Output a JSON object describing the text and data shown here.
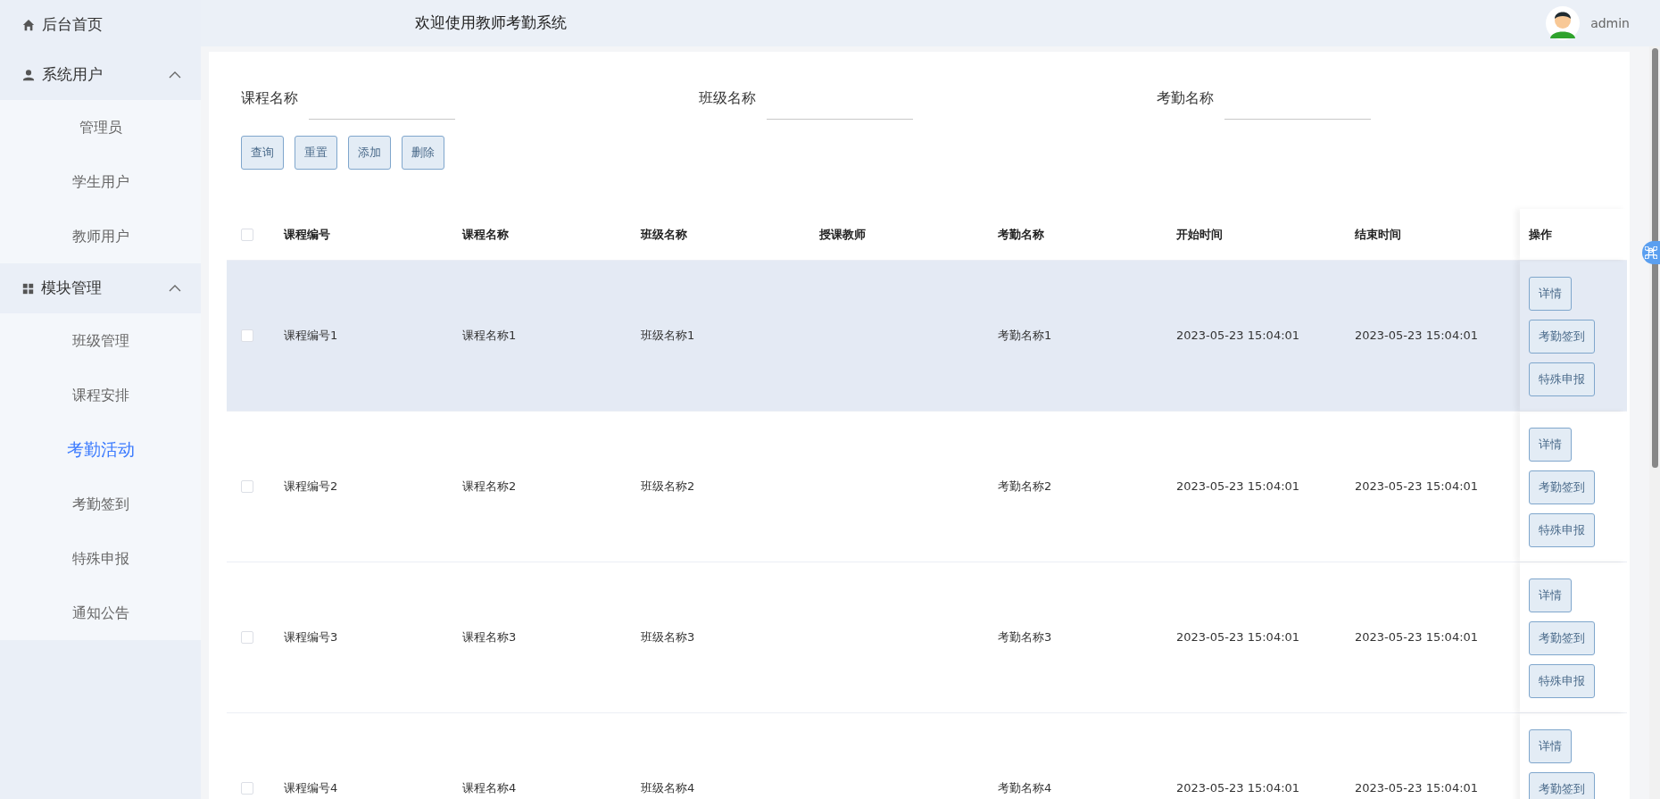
{
  "sidebar": {
    "items": [
      {
        "kind": "link",
        "label": "后台首页",
        "selected": false
      },
      {
        "kind": "group",
        "label": "系统用户",
        "expanded": true,
        "children": [
          {
            "label": "管理员",
            "selected": false
          },
          {
            "label": "学生用户",
            "selected": false
          },
          {
            "label": "教师用户",
            "selected": false
          }
        ]
      },
      {
        "kind": "group",
        "label": "模块管理",
        "expanded": true,
        "children": [
          {
            "label": "班级管理",
            "selected": false
          },
          {
            "label": "课程安排",
            "selected": false
          },
          {
            "label": "考勤活动",
            "selected": true
          },
          {
            "label": "考勤签到",
            "selected": false
          },
          {
            "label": "特殊申报",
            "selected": false
          },
          {
            "label": "通知公告",
            "selected": false
          }
        ]
      }
    ]
  },
  "header": {
    "title": "欢迎使用教师考勤系统",
    "user": "admin"
  },
  "search": {
    "fields": [
      {
        "label": "课程名称"
      },
      {
        "label": "班级名称"
      },
      {
        "label": "考勤名称"
      }
    ],
    "buttons": [
      "查询",
      "重置",
      "添加",
      "删除"
    ]
  },
  "table": {
    "select_all_checked": false,
    "columns": [
      "课程编号",
      "课程名称",
      "班级名称",
      "授课教师",
      "考勤名称",
      "开始时间",
      "结束时间"
    ],
    "action_column": "操作",
    "rows": [
      {
        "checked": false,
        "highlighted": true,
        "course_no": "课程编号1",
        "course_name": "课程名称1",
        "class_name": "班级名称1",
        "attendance_name": "考勤名称1",
        "start": "2023-05-23 15:04:01",
        "end": "2023-05-23 15:04:01",
        "actions": [
          "详情",
          "考勤签到",
          "特殊申报"
        ]
      },
      {
        "checked": false,
        "highlighted": false,
        "course_no": "课程编号2",
        "course_name": "课程名称2",
        "class_name": "班级名称2",
        "attendance_name": "考勤名称2",
        "start": "2023-05-23 15:04:01",
        "end": "2023-05-23 15:04:01",
        "actions": [
          "详情",
          "考勤签到",
          "特殊申报"
        ]
      },
      {
        "checked": false,
        "highlighted": false,
        "course_no": "课程编号3",
        "course_name": "课程名称3",
        "class_name": "班级名称3",
        "attendance_name": "考勤名称3",
        "start": "2023-05-23 15:04:01",
        "end": "2023-05-23 15:04:01",
        "actions": [
          "详情",
          "考勤签到",
          "特殊申报"
        ]
      },
      {
        "checked": false,
        "highlighted": false,
        "course_no": "课程编号4",
        "course_name": "课程名称4",
        "class_name": "班级名称4",
        "attendance_name": "考勤名称4",
        "start": "2023-05-23 15:04:01",
        "end": "2023-05-23 15:04:01",
        "actions": [
          "详情",
          "考勤签到"
        ]
      }
    ]
  }
}
